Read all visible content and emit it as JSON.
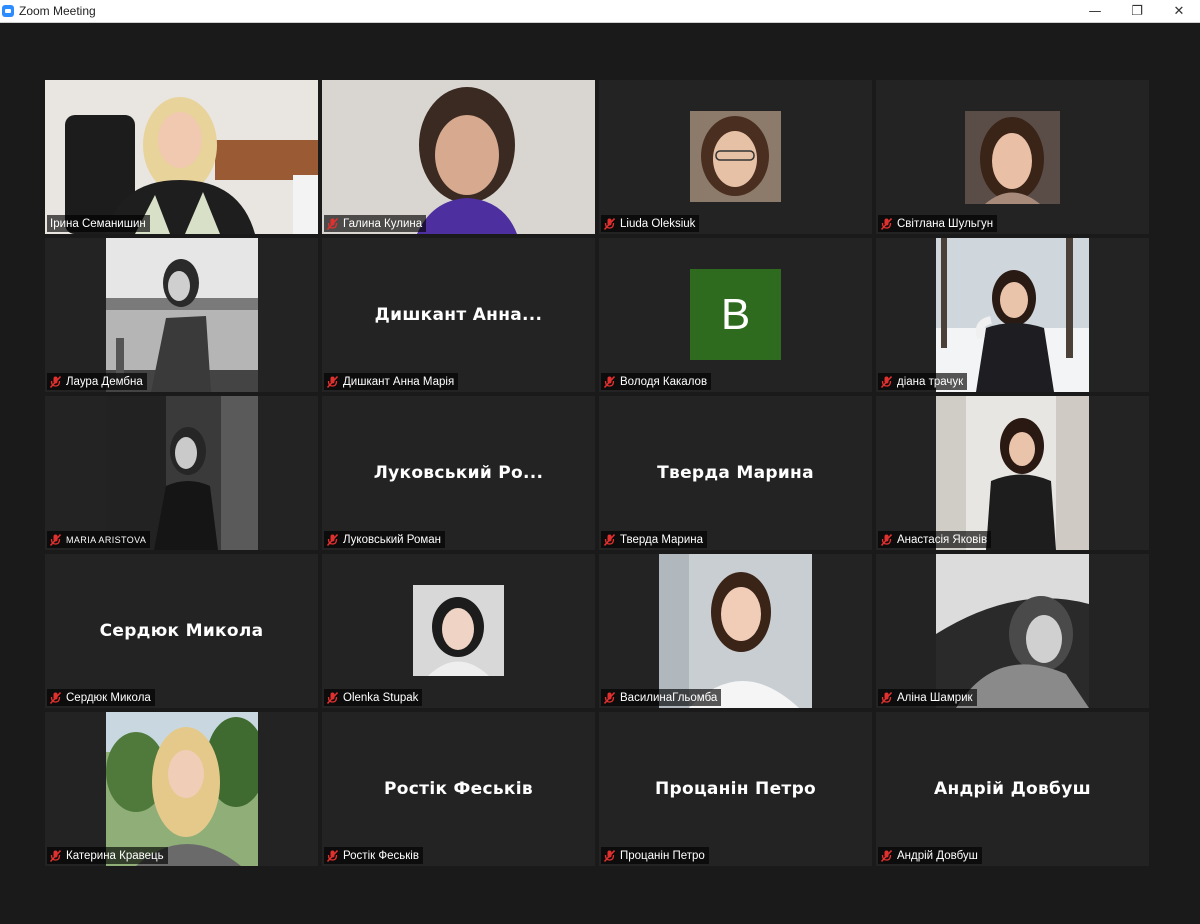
{
  "window": {
    "title": "Zoom Meeting",
    "minimize": "—",
    "restore": "❐",
    "close": "✕"
  },
  "participants": [
    {
      "name": "Ірина Семанишин",
      "muted": false,
      "active": true,
      "display": "video"
    },
    {
      "name": "Галина Кулина",
      "muted": true,
      "display": "video"
    },
    {
      "name": "Liuda Oleksiuk",
      "muted": true,
      "display": "photo"
    },
    {
      "name": "Світлана Шульгун",
      "muted": true,
      "display": "photo"
    },
    {
      "name": "Лаура Дембна",
      "muted": true,
      "display": "photo"
    },
    {
      "name": "Дишкант Анна Марія",
      "muted": true,
      "display": "name",
      "big_name": "Дишкант  Анна..."
    },
    {
      "name": "Володя Какалов",
      "muted": true,
      "display": "avatar",
      "avatar_letter": "B"
    },
    {
      "name": "діана трачук",
      "muted": true,
      "display": "photo"
    },
    {
      "name": "MARIA ARISTOVA",
      "muted": true,
      "display": "photo"
    },
    {
      "name": "Луковський Роман",
      "muted": true,
      "display": "name",
      "big_name": "Луковський  Ро..."
    },
    {
      "name": "Тверда Марина",
      "muted": true,
      "display": "name",
      "big_name": "Тверда Марина"
    },
    {
      "name": "Анастасія Яковів",
      "muted": true,
      "display": "photo"
    },
    {
      "name": "Сердюк Микола",
      "muted": true,
      "display": "name",
      "big_name": "Сердюк Микола"
    },
    {
      "name": "Olenka Stupak",
      "muted": true,
      "display": "photo"
    },
    {
      "name": "ВасилинаГльомба",
      "muted": true,
      "display": "photo"
    },
    {
      "name": "Аліна Шамрик",
      "muted": true,
      "display": "photo"
    },
    {
      "name": "Катерина Кравець",
      "muted": true,
      "display": "photo"
    },
    {
      "name": "Ростік Феськів",
      "muted": true,
      "display": "name",
      "big_name": "Ростік Феськів"
    },
    {
      "name": "Процанін Петро",
      "muted": true,
      "display": "name",
      "big_name": "Процанін Петро"
    },
    {
      "name": "Андрій Довбуш",
      "muted": true,
      "display": "name",
      "big_name": "Андрій Довбуш"
    }
  ],
  "colors": {
    "background": "#1a1a1a",
    "tile": "#232323",
    "active_border": "#c8e05a",
    "mute_icon": "#e0312f",
    "avatar_bg": "#2e6b1f"
  }
}
